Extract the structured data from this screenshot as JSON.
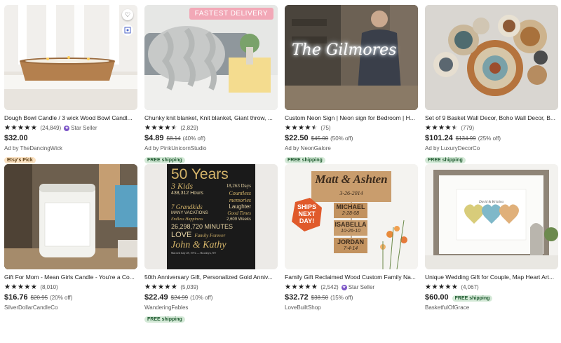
{
  "listings": [
    {
      "title": "Dough Bowl Candle / 3 wick Wood Bowl Candl...",
      "rating_count": "(24,849)",
      "star_seller": "Star Seller",
      "price": "$32.00",
      "seller": "Ad by TheDancingWick",
      "badge": "Etsy's Pick",
      "stars": 5
    },
    {
      "title": "Chunky knit blanket, Knit blanket, Giant throw, ...",
      "rating_count": "(2,829)",
      "price": "$4.89",
      "original_price": "$8.14",
      "discount": "(40% off)",
      "seller": "Ad by PinkUnicornStudio",
      "badge": "FREE shipping",
      "image_badge": "FASTEST DELIVERY",
      "stars": 4.5
    },
    {
      "title": "Custom Neon Sign | Neon sign for Bedroom | H...",
      "rating_count": "(75)",
      "price": "$22.50",
      "original_price": "$45.00",
      "discount": "(50% off)",
      "seller": "Ad by NeonGalore",
      "badge": "FREE shipping",
      "neon_text": "The Gilmores",
      "stars": 4.5
    },
    {
      "title": "Set of 9 Basket Wall Decor, Boho Wall Decor, B...",
      "rating_count": "(779)",
      "price": "$101.24",
      "original_price": "$134.99",
      "discount": "(25% off)",
      "seller": "Ad by LuxuryDecorCo",
      "badge": "FREE shipping",
      "stars": 4.5
    },
    {
      "title": "Gift For Mom - Mean Girls Candle - You're a Co...",
      "rating_count": "(8,010)",
      "price": "$16.76",
      "original_price": "$20.95",
      "discount": "(20% off)",
      "seller": "SilverDollarCandleCo",
      "stars": 5
    },
    {
      "title": "50th Anniversary Gift, Personalized Gold Anniv...",
      "rating_count": "(5,039)",
      "price": "$22.49",
      "original_price": "$24.99",
      "discount": "(10% off)",
      "seller": "WanderingFables",
      "badge": "FREE shipping",
      "stars": 5,
      "poster": {
        "heading": "50 Years",
        "kids": "3 Kids",
        "days": "18,263 Days",
        "hours": "438,312 Hours",
        "countless": "Countless",
        "memories": "memories",
        "grandkids": "7 Grandkids",
        "laughter": "Laughter",
        "vacations": "MANY VACATIONS",
        "goodtimes": "Good Times",
        "happiness": "Endless Happiness",
        "weeks": "2,609 Weeks",
        "minutes": "26,298,720 MINUTES",
        "love": "LOVE",
        "forever": "Family Forever",
        "names": "John & Kathy",
        "married": "Married July 28, 1972 — Brooklyn, NY"
      }
    },
    {
      "title": "Family Gift Reclaimed Wood Custom Family Na...",
      "rating_count": "(2,542)",
      "star_seller": "Star Seller",
      "price": "$32.72",
      "original_price": "$38.50",
      "discount": "(15% off)",
      "seller": "LoveBuiltShop",
      "stars": 5,
      "sign": {
        "heading": "Matt & Ashten",
        "date": "3-26-2014",
        "ships1": "SHIPS",
        "ships2": "NEXT",
        "ships3": "DAY!",
        "n1": "MICHAEL",
        "d1": "2-28-08",
        "n2": "ISABELLA",
        "d2": "10-26-10",
        "n3": "JORDAN",
        "d3": "7-4-14"
      }
    },
    {
      "title": "Unique Wedding Gift for Couple, Map Heart Art...",
      "rating_count": "(4,067)",
      "price": "$60.00",
      "inline_badge": "FREE shipping",
      "seller": "BasketfulOfGrace",
      "map_names": "David & Kristina",
      "stars": 5
    }
  ]
}
